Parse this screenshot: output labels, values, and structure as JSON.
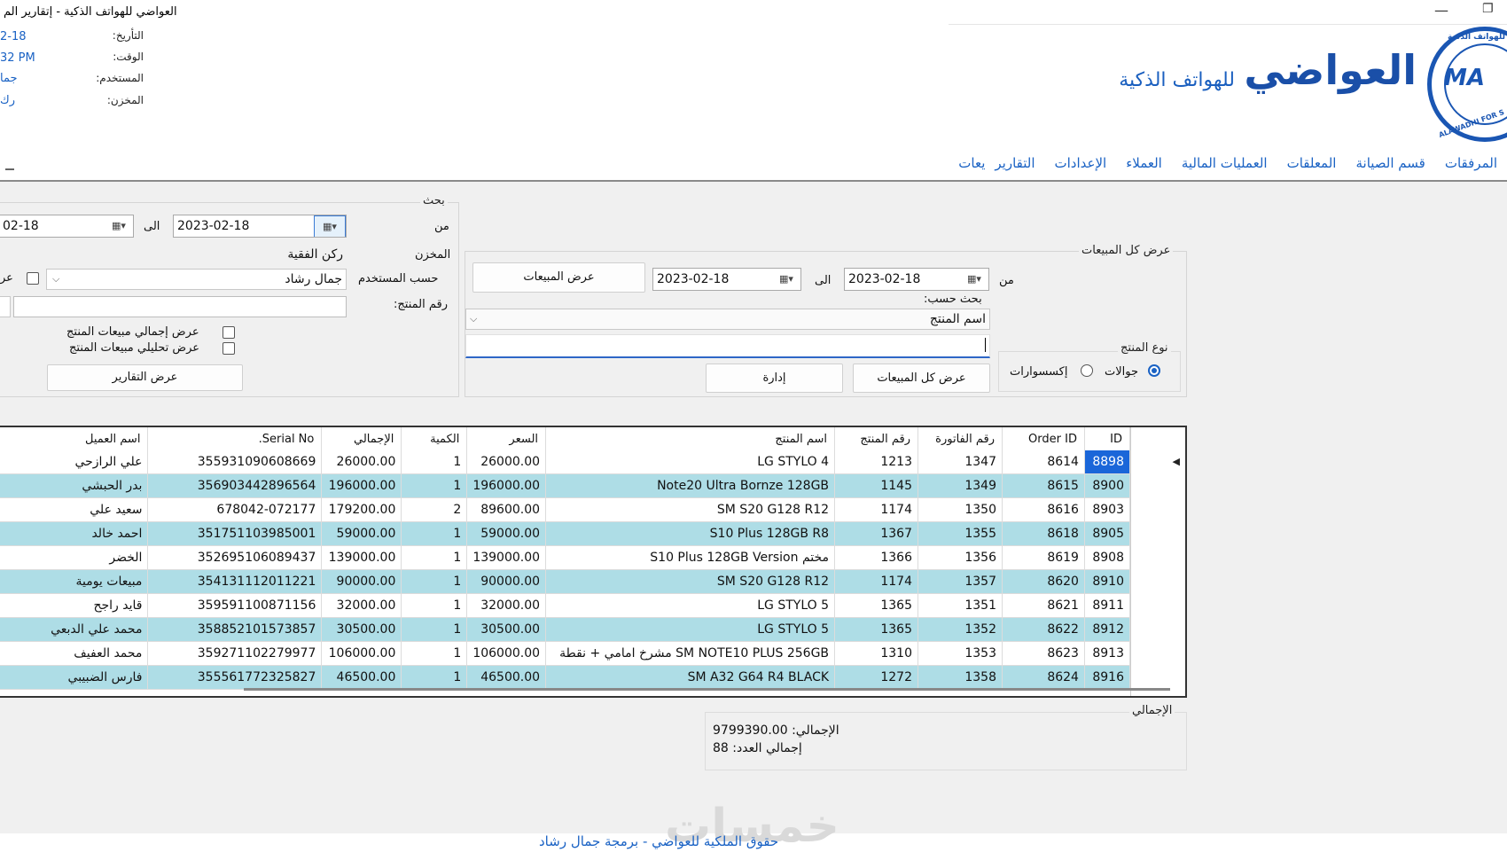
{
  "window": {
    "title": "العواضي للهواتف الذكية - إتقارير الم",
    "minimize_glyph": "—",
    "restore_glyph": "❐"
  },
  "session_info": {
    "date_label": "التأريخ:",
    "date_value": "2-18",
    "time_label": "الوقت:",
    "time_value": "32 PM",
    "user_label": "المستخدم:",
    "user_value": "جما",
    "store_label": "المخزن:",
    "store_value": "رك"
  },
  "brand": {
    "name": "العواضي",
    "tagline": "للهواتف الذكية",
    "logo_text": "MA",
    "logo_ring_text": "ALAWADHI FOR S",
    "logo_ring_top": "للهواتف الذكية",
    "color": "#1a4fa8"
  },
  "menu": [
    "يعات",
    "التقارير",
    "الإعدادات",
    "العملاء",
    "العمليات المالية",
    "المعلقات",
    "قسم الصيانة",
    "المرفقات"
  ],
  "search_panel": {
    "title": "بحث",
    "from_label": "من",
    "from_date": "2023-02-18",
    "to_label": "الى",
    "to_date": "02-18",
    "store_label": "المخزن",
    "store_value": "ركن الفقية",
    "by_user_label": "حسب المستخدم",
    "user_value": "جمال رشاد",
    "show_checkbox_label": "عر",
    "product_no_label": "رقم المنتج:",
    "product_no_value": "",
    "chk_total_sales": "عرض إجمالي مبيعات المنتج",
    "chk_analysis_sales": "عرض تحليلي مبيعات المنتج",
    "reports_button": "عرض التقارير"
  },
  "all_sales_panel": {
    "title": "عرض كل المبيعات",
    "from_label": "من",
    "from_date": "2023-02-18",
    "to_label": "الى",
    "to_date": "2023-02-18",
    "show_sales_button": "عرض المبيعات",
    "search_by_label": "بحث حسب:",
    "search_by_value": "اسم المنتج",
    "search_text": "",
    "product_type_title": "نوع المنتج",
    "radio_phones": "جوالات",
    "radio_accessories": "إكسسوارات",
    "show_all_button": "عرض كل المبيعات",
    "manage_button": "إدارة"
  },
  "grid": {
    "columns": [
      "ID",
      "Order ID",
      "رقم الفاتورة",
      "رقم المنتج",
      "اسم المنتج",
      "السعر",
      "الكمية",
      "الإجمالي",
      "Serial No.",
      "اسم العميل"
    ],
    "rows": [
      [
        "8898",
        "8614",
        "1347",
        "1213",
        "LG STYLO 4",
        "26000.00",
        "1",
        "26000.00",
        "355931090608669",
        "علي الرازحي"
      ],
      [
        "8900",
        "8615",
        "1349",
        "1145",
        "Note20 Ultra Bornze 128GB",
        "196000.00",
        "1",
        "196000.00",
        "356903442896564",
        "بدر الحبشي"
      ],
      [
        "8903",
        "8616",
        "1350",
        "1174",
        "SM S20 G128 R12",
        "89600.00",
        "2",
        "179200.00",
        "678042-072177",
        "سعيد علي"
      ],
      [
        "8905",
        "8618",
        "1355",
        "1367",
        "S10 Plus 128GB R8",
        "59000.00",
        "1",
        "59000.00",
        "351751103985001",
        "احمد خالد"
      ],
      [
        "8908",
        "8619",
        "1356",
        "1366",
        "S10 Plus 128GB Version مختم",
        "139000.00",
        "1",
        "139000.00",
        "352695106089437",
        "الخضر"
      ],
      [
        "8910",
        "8620",
        "1357",
        "1174",
        "SM S20 G128 R12",
        "90000.00",
        "1",
        "90000.00",
        "354131112011221",
        "مبيعات يومية"
      ],
      [
        "8911",
        "8621",
        "1351",
        "1365",
        "LG STYLO 5",
        "32000.00",
        "1",
        "32000.00",
        "359591100871156",
        "قايد راجح"
      ],
      [
        "8912",
        "8622",
        "1352",
        "1365",
        "LG STYLO 5",
        "30500.00",
        "1",
        "30500.00",
        "358852101573857",
        "محمد علي الدبعي"
      ],
      [
        "8913",
        "8623",
        "1353",
        "1310",
        "SM NOTE10 PLUS 256GB مشرخ امامي + نقطة",
        "106000.00",
        "1",
        "106000.00",
        "359271102279977",
        "محمد العفيف"
      ],
      [
        "8916",
        "8624",
        "1358",
        "1272",
        "SM A32  G64 R4 BLACK",
        "46500.00",
        "1",
        "46500.00",
        "355561772325827",
        "فارس الضبيبي"
      ]
    ],
    "current_row_marker": "◀",
    "alt_row_color": "#aedde6",
    "selected_color": "#1a66d9"
  },
  "totals": {
    "title": "الإجمالي",
    "total_line": "الإجمالي: 9799390.00",
    "count_line": "إجمالي العدد: 88"
  },
  "footer": {
    "text": "حقوق الملكية للعواضي - برمجة جمال رشاد",
    "watermark": "خمسات"
  }
}
